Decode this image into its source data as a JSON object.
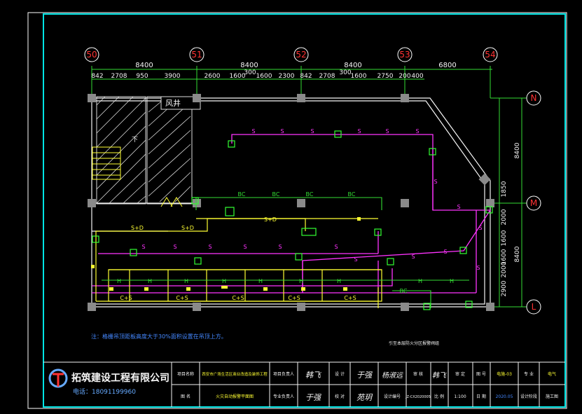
{
  "colors": {
    "background": "#000000",
    "border": "#ffffff",
    "frame": "#00e5e5",
    "axis": "#f5f5f5",
    "dimension": "#33dd33",
    "column": "#8a8a8a",
    "sprinkler_pipe": "#ff33ff",
    "bus_pipe": "#ffff33",
    "device": "#33ff33",
    "note": "#4488ff",
    "title_text": "#ffff33",
    "red_text": "#ff3333"
  },
  "axes": {
    "vertical": [
      "50",
      "51",
      "52",
      "53",
      "54"
    ],
    "horizontal": [
      "N",
      "M",
      "L"
    ]
  },
  "dimensions": {
    "top_totals": [
      "8400",
      "8400",
      "8400",
      "6800"
    ],
    "top_segments": [
      "842",
      "2708",
      "950",
      "3900",
      "2600",
      "1600",
      "300",
      "1600",
      "2300",
      "842",
      "2708",
      "300",
      "1600",
      "2750",
      "200",
      "400"
    ],
    "right_outer": [
      "8400",
      "8400"
    ],
    "right_inner": [
      "1850",
      "2000",
      "1600",
      "1600",
      "2000",
      "2900"
    ]
  },
  "plan_labels": {
    "shaft": "风井",
    "stair_down": "下",
    "pipe_s": "S",
    "pipe_bc": "BC",
    "pipe_sd": "S+D",
    "pipe_h": "H",
    "pipe_cs": "C+S"
  },
  "notes": {
    "main_note": "注：格栅吊顶距板高度大于30%面积设置在吊顶上方。",
    "side_note": "引至本层防火分区报警阀组"
  },
  "title_block": {
    "company_name": "拓筑建设工程有限公司",
    "phone": "电话：18091199960",
    "project_name_label": "项目名称",
    "project_name_value": "西安市广场生活区商业改造及装饰工程",
    "drawing_name_label": "图 名",
    "drawing_name_value": "火灾自动报警平面图",
    "project_lead_label": "项目负责人",
    "project_lead_sig": "韩飞",
    "design_label": "设 计",
    "design_sig": "于强",
    "review_label": "审 核",
    "review_sig": "杨淑远",
    "approve_label": "审 定",
    "approve_sig": "韩飞",
    "drawing_no_label": "图 号",
    "drawing_no_value": "电施-03",
    "discipline_label": "专 业",
    "discipline_value": "电气",
    "specialty_lead_label": "专业负责人",
    "specialty_lead_sig": "于强",
    "check_label": "校 对",
    "check_sig": "苑玥",
    "design_no_label": "设计编号",
    "design_no_value": "JZ-CX2020005",
    "scale_label": "比 例",
    "scale_value": "1:100",
    "date_label": "日 期",
    "date_value": "2020.05",
    "stage_label": "设计阶段",
    "stage_value": "施工图"
  }
}
